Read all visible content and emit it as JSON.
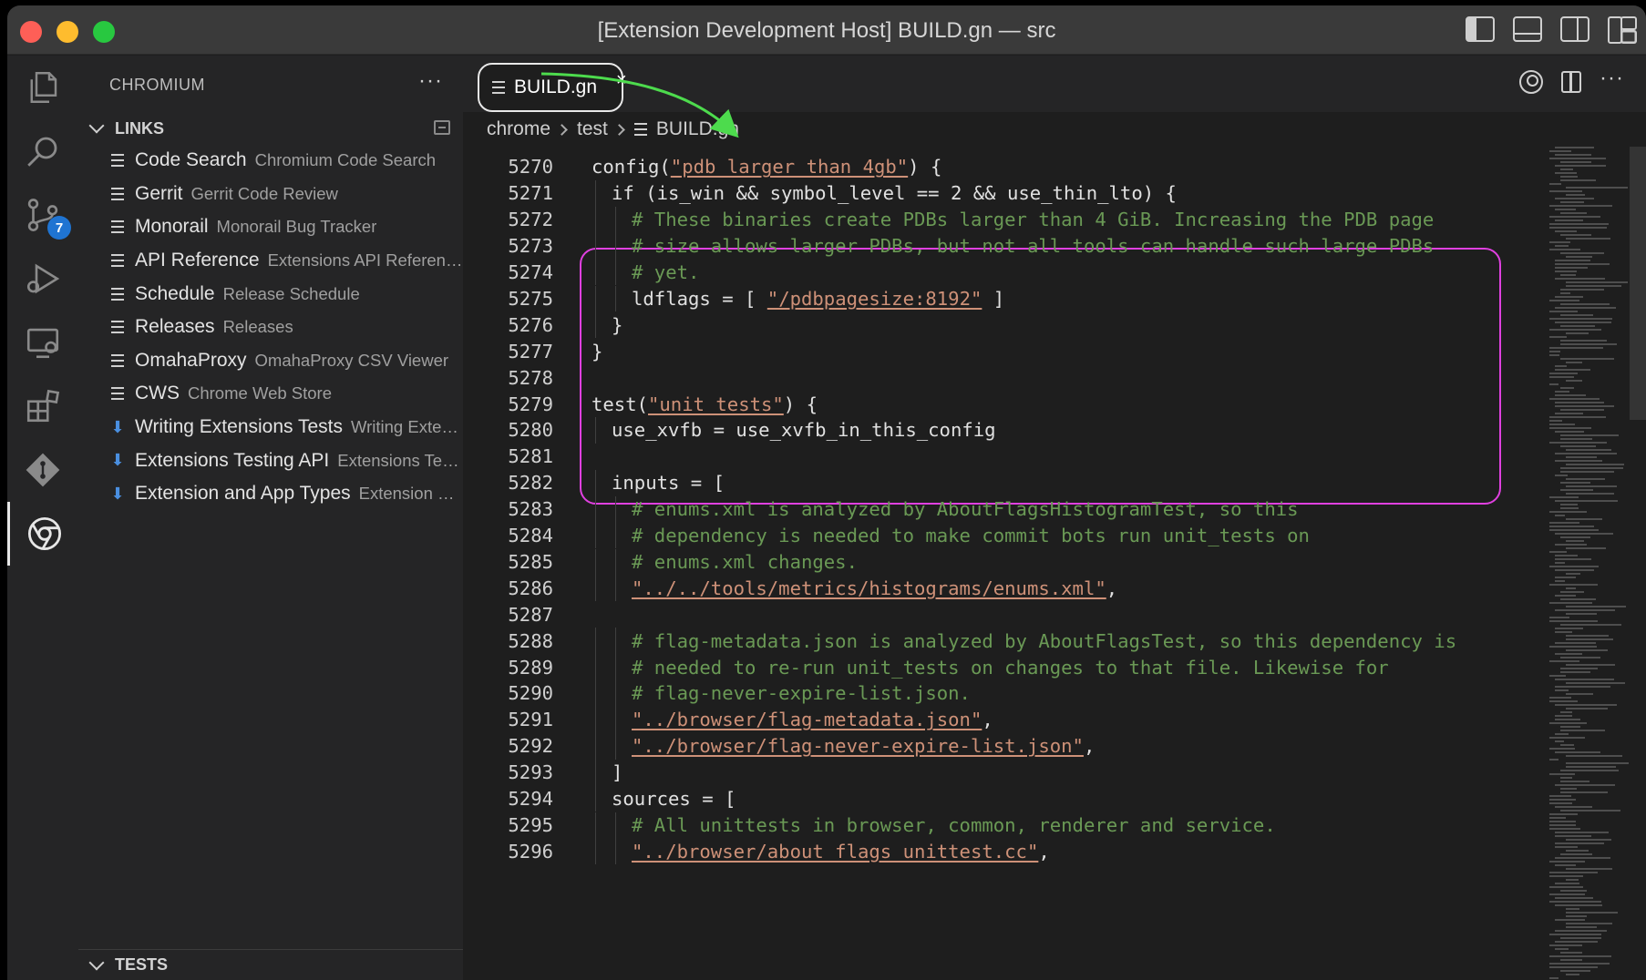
{
  "window": {
    "title": "[Extension Development Host] BUILD.gn — src"
  },
  "activity_bar": {
    "source_control_badge": "7"
  },
  "sidebar": {
    "title": "CHROMIUM",
    "more": "···",
    "links_section": "LINKS",
    "tests_section": "TESTS",
    "links": [
      {
        "icon": "lines-icon",
        "name": "Code Search",
        "desc": "Chromium Code Search"
      },
      {
        "icon": "lines-icon",
        "name": "Gerrit",
        "desc": "Gerrit Code Review"
      },
      {
        "icon": "lines-icon",
        "name": "Monorail",
        "desc": "Monorail Bug Tracker"
      },
      {
        "icon": "lines-icon",
        "name": "API Reference",
        "desc": "Extensions API Reference"
      },
      {
        "icon": "lines-icon",
        "name": "Schedule",
        "desc": "Release Schedule"
      },
      {
        "icon": "lines-icon",
        "name": "Releases",
        "desc": "Releases"
      },
      {
        "icon": "lines-icon",
        "name": "OmahaProxy",
        "desc": "OmahaProxy CSV Viewer"
      },
      {
        "icon": "lines-icon",
        "name": "CWS",
        "desc": "Chrome Web Store"
      },
      {
        "icon": "download-icon",
        "name": "Writing Extensions Tests",
        "desc": "Writing Extensions Tests"
      },
      {
        "icon": "download-icon",
        "name": "Extensions Testing API",
        "desc": "Extensions Testing API"
      },
      {
        "icon": "download-icon",
        "name": "Extension and App Types",
        "desc": "Extension and App Types"
      }
    ]
  },
  "editor": {
    "tab_label": "BUILD.gn",
    "tab_close": "×",
    "more": "···",
    "breadcrumb": [
      "chrome",
      "test",
      "BUILD.gn"
    ],
    "code_lines": [
      {
        "n": "5270",
        "indent": 0,
        "parts": [
          [
            "t",
            "config("
          ],
          [
            "s",
            "\"pdb_larger_than_4gb\""
          ],
          [
            "t",
            ") {"
          ]
        ]
      },
      {
        "n": "5271",
        "indent": 1,
        "parts": [
          [
            "t",
            "if (is_win && symbol_level == 2 && use_thin_lto) {"
          ]
        ]
      },
      {
        "n": "5272",
        "indent": 2,
        "parts": [
          [
            "c",
            "# These binaries create PDBs larger than 4 GiB. Increasing the PDB page"
          ]
        ]
      },
      {
        "n": "5273",
        "indent": 2,
        "parts": [
          [
            "c",
            "# size allows larger PDBs, but not all tools can handle such large PDBs"
          ]
        ]
      },
      {
        "n": "5274",
        "indent": 2,
        "parts": [
          [
            "c",
            "# yet."
          ]
        ]
      },
      {
        "n": "5275",
        "indent": 2,
        "parts": [
          [
            "t",
            "ldflags = [ "
          ],
          [
            "s",
            "\"/pdbpagesize:8192\""
          ],
          [
            "t",
            " ]"
          ]
        ]
      },
      {
        "n": "5276",
        "indent": 1,
        "parts": [
          [
            "t",
            "}"
          ]
        ]
      },
      {
        "n": "5277",
        "indent": 0,
        "parts": [
          [
            "t",
            "}"
          ]
        ]
      },
      {
        "n": "5278",
        "indent": 0,
        "parts": []
      },
      {
        "n": "5279",
        "indent": 0,
        "parts": [
          [
            "t",
            "test("
          ],
          [
            "s",
            "\"unit_tests\""
          ],
          [
            "t",
            ") {"
          ]
        ]
      },
      {
        "n": "5280",
        "indent": 1,
        "parts": [
          [
            "t",
            "use_xvfb = use_xvfb_in_this_config"
          ]
        ]
      },
      {
        "n": "5281",
        "indent": 0,
        "parts": []
      },
      {
        "n": "5282",
        "indent": 1,
        "parts": [
          [
            "t",
            "inputs = ["
          ]
        ]
      },
      {
        "n": "5283",
        "indent": 2,
        "parts": [
          [
            "c",
            "# enums.xml is analyzed by AboutFlagsHistogramTest, so this"
          ]
        ]
      },
      {
        "n": "5284",
        "indent": 2,
        "parts": [
          [
            "c",
            "# dependency is needed to make commit bots run unit_tests on"
          ]
        ]
      },
      {
        "n": "5285",
        "indent": 2,
        "parts": [
          [
            "c",
            "# enums.xml changes."
          ]
        ]
      },
      {
        "n": "5286",
        "indent": 2,
        "parts": [
          [
            "s",
            "\"../../tools/metrics/histograms/enums.xml\""
          ],
          [
            "t",
            ","
          ]
        ]
      },
      {
        "n": "5287",
        "indent": 0,
        "parts": []
      },
      {
        "n": "5288",
        "indent": 2,
        "parts": [
          [
            "c",
            "# flag-metadata.json is analyzed by AboutFlagsTest, so this dependency is"
          ]
        ]
      },
      {
        "n": "5289",
        "indent": 2,
        "parts": [
          [
            "c",
            "# needed to re-run unit_tests on changes to that file. Likewise for"
          ]
        ]
      },
      {
        "n": "5290",
        "indent": 2,
        "parts": [
          [
            "c",
            "# flag-never-expire-list.json."
          ]
        ]
      },
      {
        "n": "5291",
        "indent": 2,
        "parts": [
          [
            "s",
            "\"../browser/flag-metadata.json\""
          ],
          [
            "t",
            ","
          ]
        ]
      },
      {
        "n": "5292",
        "indent": 2,
        "parts": [
          [
            "s",
            "\"../browser/flag-never-expire-list.json\""
          ],
          [
            "t",
            ","
          ]
        ]
      },
      {
        "n": "5293",
        "indent": 1,
        "parts": [
          [
            "t",
            "]"
          ]
        ]
      },
      {
        "n": "5294",
        "indent": 1,
        "parts": [
          [
            "t",
            "sources = ["
          ]
        ]
      },
      {
        "n": "5295",
        "indent": 2,
        "parts": [
          [
            "c",
            "# All unittests in browser, common, renderer and service."
          ]
        ]
      },
      {
        "n": "5296",
        "indent": 2,
        "parts": [
          [
            "s",
            "\"../browser/about_flags_unittest.cc\""
          ],
          [
            "t",
            ","
          ]
        ]
      }
    ]
  },
  "colors": {
    "highlight_box": "#e040e0",
    "arrow": "#4ddb4d",
    "comment": "#6a9955",
    "string": "#ce9178"
  }
}
